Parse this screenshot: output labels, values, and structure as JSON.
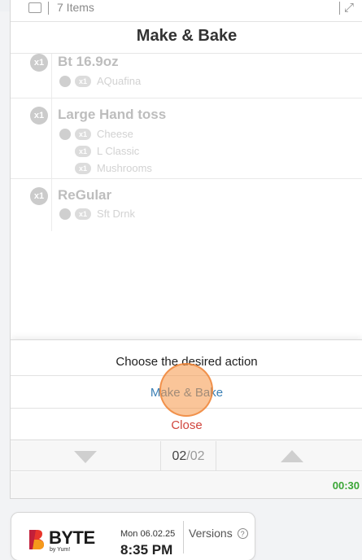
{
  "items_bar": {
    "items_label": "7 Items"
  },
  "page_title": "Make & Bake",
  "orders": [
    {
      "qty": "x1",
      "name": "Bt 16.9oz",
      "mods": [
        {
          "qty": "x1",
          "text": "AQuafina",
          "dot": true
        }
      ]
    },
    {
      "qty": "x1",
      "name": "Large Hand toss",
      "mods": [
        {
          "qty": "x1",
          "text": "Cheese",
          "dot": true
        },
        {
          "qty": "x1",
          "text": "L Classic",
          "dot": false
        },
        {
          "qty": "x1",
          "text": "Mushrooms",
          "dot": false
        }
      ]
    },
    {
      "qty": "x1",
      "name": "ReGular",
      "mods": [
        {
          "qty": "x1",
          "text": "Sft Drnk",
          "dot": true
        }
      ]
    }
  ],
  "dialog": {
    "heading": "Choose the desired action",
    "action": "Make & Bake",
    "close": "Close"
  },
  "pager": {
    "current": "02",
    "separator": "/",
    "total": "02"
  },
  "timer": "00:30",
  "footer": {
    "brand": "BYTE",
    "brand_sub": "by Yum!",
    "date": "Mon 06.02.25",
    "time": "8:35 PM",
    "versions": "Versions",
    "help_glyph": "?"
  },
  "colors": {
    "action_blue": "#3a7fb5",
    "close_red": "#d0443c",
    "timer_green": "#3aa636",
    "brand_red": "#e8352b",
    "brand_orange": "#f59a1b"
  }
}
